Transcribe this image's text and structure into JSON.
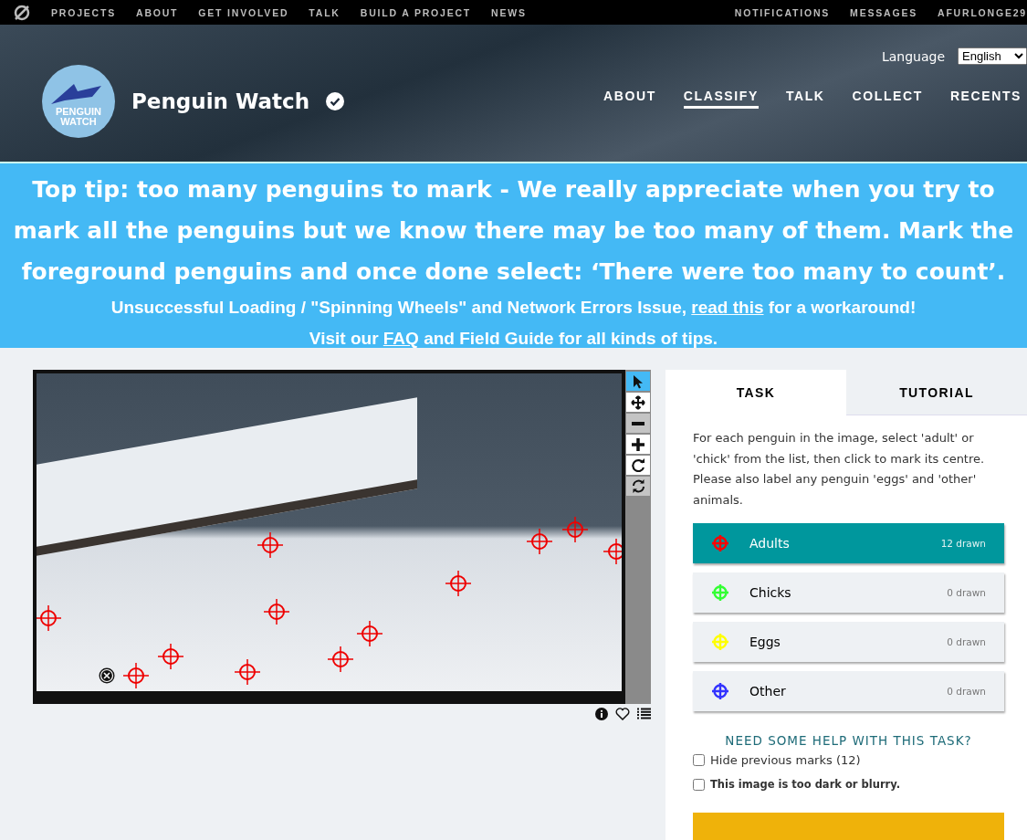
{
  "top_nav": {
    "links": [
      "PROJECTS",
      "ABOUT",
      "GET INVOLVED",
      "TALK",
      "BUILD A PROJECT",
      "NEWS"
    ],
    "account_links": [
      "NOTIFICATIONS",
      "MESSAGES",
      "AFURLONGE29"
    ]
  },
  "header": {
    "logo_text": [
      "PENGUIN",
      "WATCH"
    ],
    "title": "Penguin Watch",
    "verified": true,
    "language_label": "Language",
    "language_value": "English",
    "nav": [
      {
        "label": "ABOUT",
        "selected": false
      },
      {
        "label": "CLASSIFY",
        "selected": true
      },
      {
        "label": "TALK",
        "selected": false
      },
      {
        "label": "COLLECT",
        "selected": false
      },
      {
        "label": "RECENTS",
        "selected": false
      }
    ]
  },
  "banner": {
    "tip": "Top tip: too many penguins to mark - We really appreciate when you try to mark all the penguins but we know there may be too many of them. Mark the foreground penguins and once done select: ‘There were too many to count’.",
    "line_1": {
      "before": "Unsuccessful Loading / \"Spinning Wheels\" and Network Errors Issue,",
      "link": "read this",
      "after": "for a workaround!"
    },
    "line_2": {
      "before": "Visit our",
      "link": "FAQ",
      "after": "and Field Guide for all kinds of tips."
    }
  },
  "viewer": {
    "tools": [
      {
        "kind": "pointer",
        "selected": true,
        "disabled": false
      },
      {
        "kind": "move",
        "selected": false,
        "disabled": false
      },
      {
        "kind": "zoom-out",
        "selected": false,
        "disabled": true
      },
      {
        "kind": "zoom-in",
        "selected": false,
        "disabled": false
      },
      {
        "kind": "rotate",
        "selected": false,
        "disabled": false
      },
      {
        "kind": "reset",
        "selected": false,
        "disabled": true
      }
    ]
  },
  "panel": {
    "tabs": [
      {
        "label": "TASK",
        "selected": true
      },
      {
        "label": "TUTORIAL",
        "selected": false
      }
    ],
    "instructions": "For each penguin in the image, select 'adult' or 'chick' from the list, then click to mark its centre. Please also label any penguin 'eggs' and 'other' animals.",
    "choices": [
      {
        "label": "Adults",
        "count": "12 drawn",
        "color": "#ff0000",
        "selected": true
      },
      {
        "label": "Chicks",
        "count": "0 drawn",
        "color": "#33ff33",
        "selected": false
      },
      {
        "label": "Eggs",
        "count": "0 drawn",
        "color": "#ffff00",
        "selected": false
      },
      {
        "label": "Other",
        "count": "0 drawn",
        "color": "#3333ff",
        "selected": false
      }
    ],
    "help": "NEED SOME HELP WITH THIS TASK?",
    "options": [
      {
        "label": "Hide previous marks (12)",
        "checked": false,
        "bold": false
      },
      {
        "label": "This image is too dark or blurry.",
        "checked": false,
        "bold": true
      }
    ]
  }
}
